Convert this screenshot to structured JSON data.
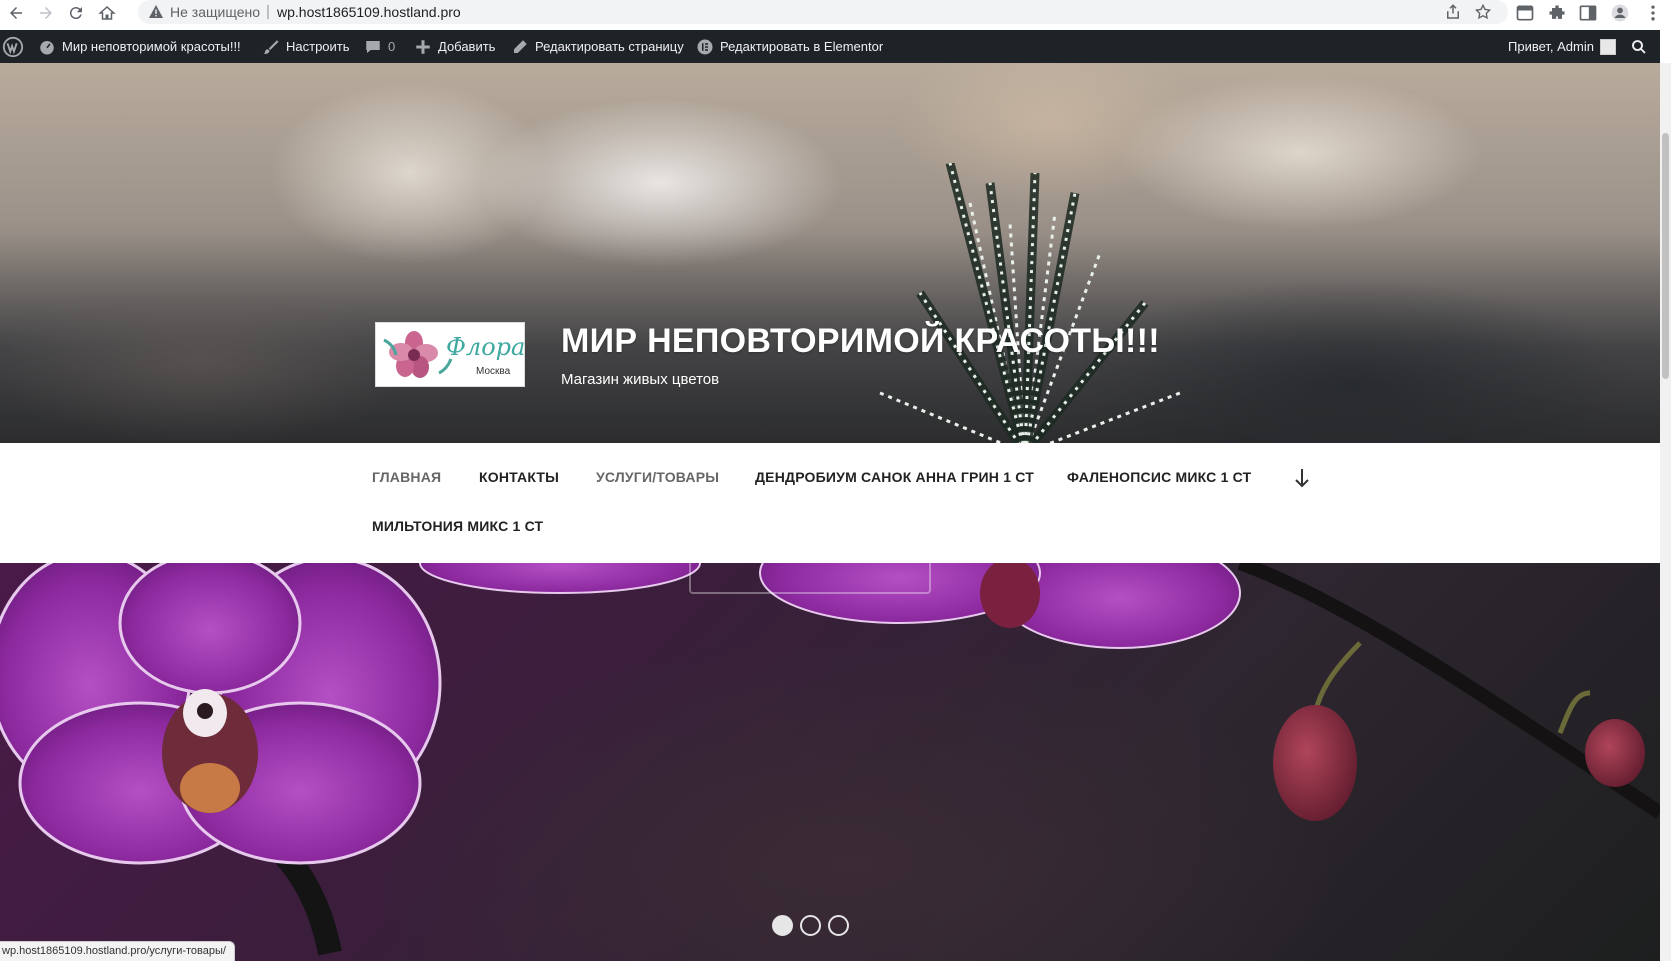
{
  "browser": {
    "security_label": "Не защищено",
    "separator": "|",
    "url": "wp.host1865109.hostland.pro"
  },
  "admin_bar": {
    "site_name": "Мир неповторимой красоты!!!",
    "customize": "Настроить",
    "comments_count": "0",
    "add_new": "Добавить",
    "edit_page": "Редактировать страницу",
    "edit_elementor": "Редактировать в Elementor",
    "greeting": "Привет, Admin"
  },
  "header": {
    "title": "МИР НЕПОВТОРИМОЙ КРАСОТЫ!!!",
    "tagline": "Магазин живых цветов",
    "logo_text": "Флора",
    "logo_subtext": "Москва"
  },
  "nav": {
    "items": [
      {
        "label": "ГЛАВНАЯ"
      },
      {
        "label": "КОНТАКТЫ"
      },
      {
        "label": "УСЛУГИ/ТОВАРЫ"
      },
      {
        "label": "ДЕНДРОБИУМ САНОК АННА ГРИН 1 СТ"
      },
      {
        "label": "ФАЛЕНОПСИС МИКС 1 СТ"
      },
      {
        "label": "МИЛЬТОНИЯ МИКС 1 СТ"
      }
    ]
  },
  "slider": {
    "slide_count": 3,
    "active_slide": 1
  },
  "status_bar": {
    "link_preview": "wp.host1865109.hostland.pro/услуги-товары/"
  },
  "colors": {
    "admin_bar_bg": "#1d2327",
    "nav_text": "#222222",
    "title_text": "#ffffff",
    "orchid_purple": "#a23bb3"
  }
}
